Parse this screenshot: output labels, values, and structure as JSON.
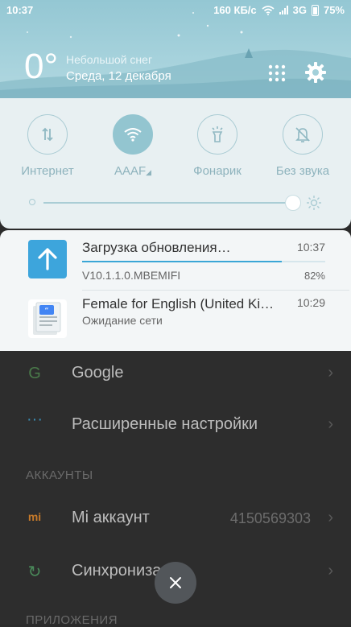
{
  "status_bar": {
    "time": "10:37",
    "speed": "160 КБ/с",
    "network": "3G",
    "battery": "75%"
  },
  "weather": {
    "temp": "0°",
    "condition": "Небольшой снег",
    "date": "Среда, 12 декабря"
  },
  "header_icons": [
    "grid-icon",
    "gear-icon"
  ],
  "quick_settings": [
    {
      "label": "Интернет",
      "icon": "data-transfer-icon",
      "active": false
    },
    {
      "label": "AAAF",
      "icon": "wifi-icon",
      "active": true
    },
    {
      "label": "Фонарик",
      "icon": "flashlight-icon",
      "active": false
    },
    {
      "label": "Без звука",
      "icon": "bell-off-icon",
      "active": false
    }
  ],
  "brightness": {
    "level": 0.94
  },
  "notifications": [
    {
      "title": "Загрузка обновления…",
      "subtitle": "V10.1.1.0.MBEMIFI",
      "time": "10:37",
      "progress_text": "82%",
      "progress": 0.82,
      "icon": "upload-arrow-icon",
      "icon_color": "#3da5dc"
    },
    {
      "title": "Female for English (United Ki…",
      "subtitle": "Ожидание сети",
      "time": "10:29",
      "icon": "tts-document-icon"
    }
  ],
  "background_settings": {
    "items": [
      {
        "label": "Google",
        "icon": "google-icon"
      },
      {
        "label": "Расширенные настройки",
        "icon": "more-dots-icon"
      }
    ],
    "section_accounts": "АККАУНТЫ",
    "account_items": [
      {
        "label": "Mi аккаунт",
        "value": "4150569303",
        "icon": "mi-icon"
      },
      {
        "label": "Синхронизация",
        "icon": "sync-icon"
      }
    ],
    "section_apps": "ПРИЛОЖЕНИЯ"
  },
  "colors": {
    "accent": "#3da5dc",
    "tile_active": "#93c5d0",
    "shade_bg": "#e8f0f2"
  }
}
